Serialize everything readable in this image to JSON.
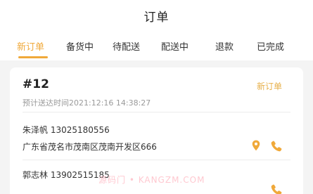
{
  "header": {
    "title": "订单"
  },
  "tabs": [
    {
      "label": "新订单",
      "active": true
    },
    {
      "label": "备货中",
      "active": false
    },
    {
      "label": "待配送",
      "active": false
    },
    {
      "label": "配送中",
      "active": false
    },
    {
      "label": "退款",
      "active": false
    },
    {
      "label": "已完成",
      "active": false
    }
  ],
  "order": {
    "number": "#12",
    "status": "新订单",
    "eta": "预计送达时间2021:12:16 14:38:27",
    "customer": {
      "contact": "朱泽帆 13025180556",
      "address": "广东省茂名市茂南区茂南开发区666"
    }
  },
  "next_order": {
    "contact": "郭志林 13902515185"
  },
  "watermark": "源码门 • KANGZM.COM",
  "colors": {
    "accent": "#f0a93a",
    "badge": "#e7b04a",
    "muted": "#9a9a9a"
  },
  "icons": [
    "location-pin-icon",
    "phone-icon"
  ]
}
